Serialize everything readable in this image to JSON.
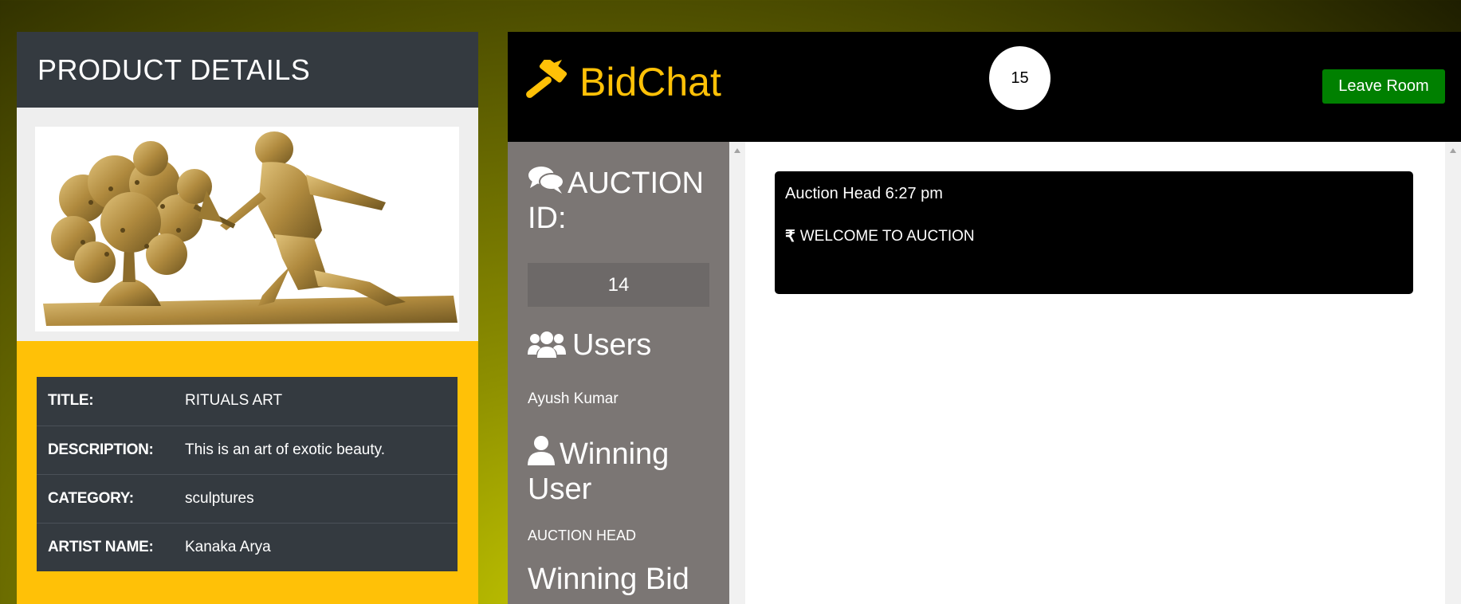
{
  "product": {
    "header": "PRODUCT DETAILS",
    "rows": [
      {
        "label": "TITLE:",
        "value": "RITUALS ART"
      },
      {
        "label": "DESCRIPTION:",
        "value": "This is an art of exotic beauty."
      },
      {
        "label": "CATEGORY:",
        "value": "sculptures"
      },
      {
        "label": "ARTIST NAME:",
        "value": "Kanaka Arya"
      }
    ]
  },
  "chat": {
    "brand": "BidChat",
    "counter": "15",
    "leave_label": "Leave Room",
    "sidebar": {
      "auction_id_heading": "AUCTION ID:",
      "auction_id": "14",
      "users_heading": "Users",
      "users": [
        "Ayush Kumar"
      ],
      "winning_user_heading": "Winning User",
      "winning_user": "AUCTION HEAD",
      "winning_bid_heading": "Winning Bid"
    },
    "messages": [
      {
        "meta": "Auction Head 6:27 pm",
        "text": "WELCOME TO AUCTION"
      }
    ]
  },
  "colors": {
    "accent": "#ffc107",
    "dark": "#343a40",
    "leave_button": "#008000",
    "sidebar": "#7b7674"
  },
  "icons": [
    "hammer-icon",
    "comments-icon",
    "users-icon",
    "user-icon",
    "rupee-icon"
  ]
}
